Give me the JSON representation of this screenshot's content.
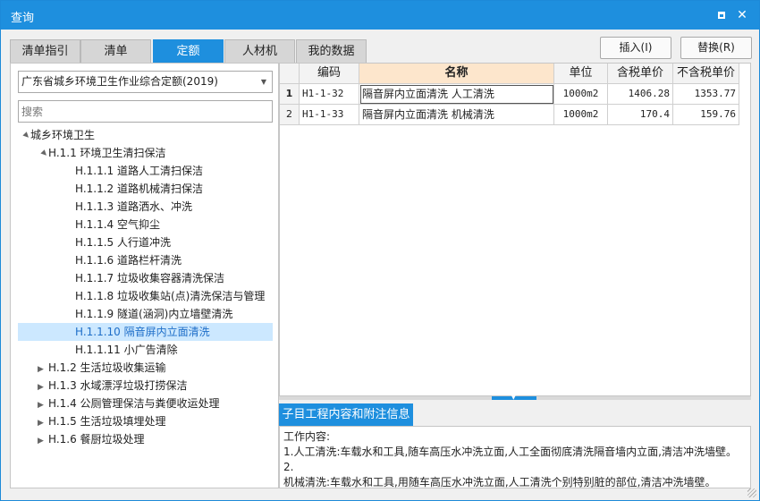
{
  "window": {
    "title": "查询"
  },
  "tabs": [
    {
      "label": "清单指引",
      "active": false
    },
    {
      "label": "清单",
      "active": false
    },
    {
      "label": "定额",
      "active": true
    },
    {
      "label": "人材机",
      "active": false
    },
    {
      "label": "我的数据",
      "active": false
    }
  ],
  "actions": {
    "insert_label": "插入(I)",
    "replace_label": "替换(R)"
  },
  "left": {
    "library_selected": "广东省城乡环境卫生作业综合定额(2019)",
    "search_placeholder": "搜索",
    "tree": [
      {
        "label": "城乡环境卫生",
        "level": 0,
        "caret": "▲",
        "selected": false
      },
      {
        "label": "H.1.1 环境卫生清扫保洁",
        "level": 1,
        "caret": "▲",
        "selected": false
      },
      {
        "label": "H.1.1.1 道路人工清扫保洁",
        "level": 2,
        "caret": "",
        "selected": false
      },
      {
        "label": "H.1.1.2 道路机械清扫保洁",
        "level": 2,
        "caret": "",
        "selected": false
      },
      {
        "label": "H.1.1.3 道路洒水、冲洗",
        "level": 2,
        "caret": "",
        "selected": false
      },
      {
        "label": "H.1.1.4 空气抑尘",
        "level": 2,
        "caret": "",
        "selected": false
      },
      {
        "label": "H.1.1.5 人行道冲洗",
        "level": 2,
        "caret": "",
        "selected": false
      },
      {
        "label": "H.1.1.6 道路栏杆清洗",
        "level": 2,
        "caret": "",
        "selected": false
      },
      {
        "label": "H.1.1.7 垃圾收集容器清洗保洁",
        "level": 2,
        "caret": "",
        "selected": false
      },
      {
        "label": "H.1.1.8 垃圾收集站(点)清洗保洁与管理",
        "level": 2,
        "caret": "",
        "selected": false
      },
      {
        "label": "H.1.1.9 隧道(涵洞)内立墙壁清洗",
        "level": 2,
        "caret": "",
        "selected": false
      },
      {
        "label": "H.1.1.10 隔音屏内立面清洗",
        "level": 2,
        "caret": "",
        "selected": true
      },
      {
        "label": "H.1.1.11 小广告清除",
        "level": 2,
        "caret": "",
        "selected": false
      },
      {
        "label": "H.1.2 生活垃圾收集运输",
        "level": 1,
        "caret": "▶",
        "selected": false
      },
      {
        "label": "H.1.3 水域漂浮垃圾打捞保洁",
        "level": 1,
        "caret": "▶",
        "selected": false
      },
      {
        "label": "H.1.4 公厕管理保洁与粪便收运处理",
        "level": 1,
        "caret": "▶",
        "selected": false
      },
      {
        "label": "H.1.5 生活垃圾填埋处理",
        "level": 1,
        "caret": "▶",
        "selected": false
      },
      {
        "label": "H.1.6 餐厨垃圾处理",
        "level": 1,
        "caret": "▶",
        "selected": false
      }
    ]
  },
  "grid": {
    "headers": {
      "code": "编码",
      "name": "名称",
      "unit": "单位",
      "price_tax": "含税单价",
      "price_notax": "不含税单价"
    },
    "rows": [
      {
        "no": "1",
        "code": "H1-1-32",
        "name": "隔音屏内立面清洗 人工清洗",
        "unit": "1000m2",
        "price_tax": "1406.28",
        "price_notax": "1353.77"
      },
      {
        "no": "2",
        "code": "H1-1-33",
        "name": "隔音屏内立面清洗 机械清洗",
        "unit": "1000m2",
        "price_tax": "170.4",
        "price_notax": "159.76"
      }
    ]
  },
  "info": {
    "tab_label": "子目工程内容和附注信息",
    "line1": "工作内容:",
    "line2": "1.人工清洗:车载水和工具,随车高压水冲洗立面,人工全面彻底清洗隔音墙内立面,清洁冲洗墙壁。2.",
    "line3": "机械清洗:车载水和工具,用随车高压水冲洗立面,人工清洗个别特别脏的部位,清洁冲洗墙壁。"
  },
  "icons": {
    "restore": "restore-icon",
    "close": "close-icon",
    "dropdown": "chevron-down-icon",
    "splitter": "collapse-arrow-icon"
  },
  "colors": {
    "accent": "#1e8fde",
    "header_highlight": "#fde6cc",
    "selection": "#cce8ff"
  }
}
